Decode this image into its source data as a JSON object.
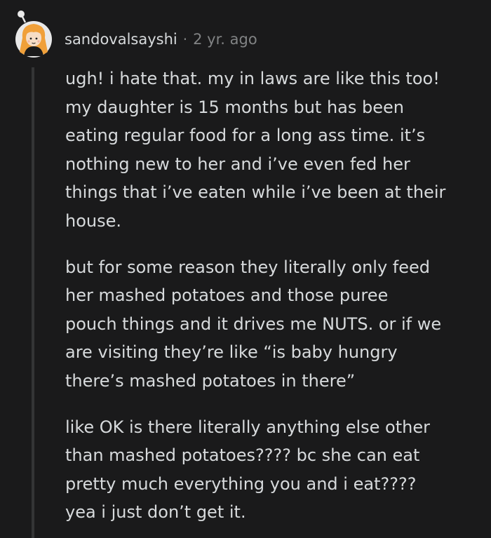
{
  "comment": {
    "username": "sandovalsayshi",
    "separator": "·",
    "timestamp": "2 yr. ago",
    "avatar_icon": "user-avatar-icon",
    "colors": {
      "background": "#1a1a1b",
      "text": "#d7dadc",
      "muted": "#818384",
      "thread_line": "#343536"
    },
    "paragraphs": [
      "ugh! i hate that. my in laws are like this too!\nmy daughter is 15 months but has been\neating regular food for a long ass time. it’s\nnothing new to her and i’ve even fed her\nthings that i’ve eaten while i’ve been at their\nhouse.",
      "but for some reason they literally only feed\nher mashed potatoes and those puree\npouch things and it drives me NUTS. or if we\nare visiting they’re like “is baby hungry\nthere’s mashed potatoes in there”",
      "like OK is there literally anything else other\nthan mashed potatoes???? bc she can eat\npretty much everything you and i eat????\nyea i just don’t get it."
    ]
  }
}
